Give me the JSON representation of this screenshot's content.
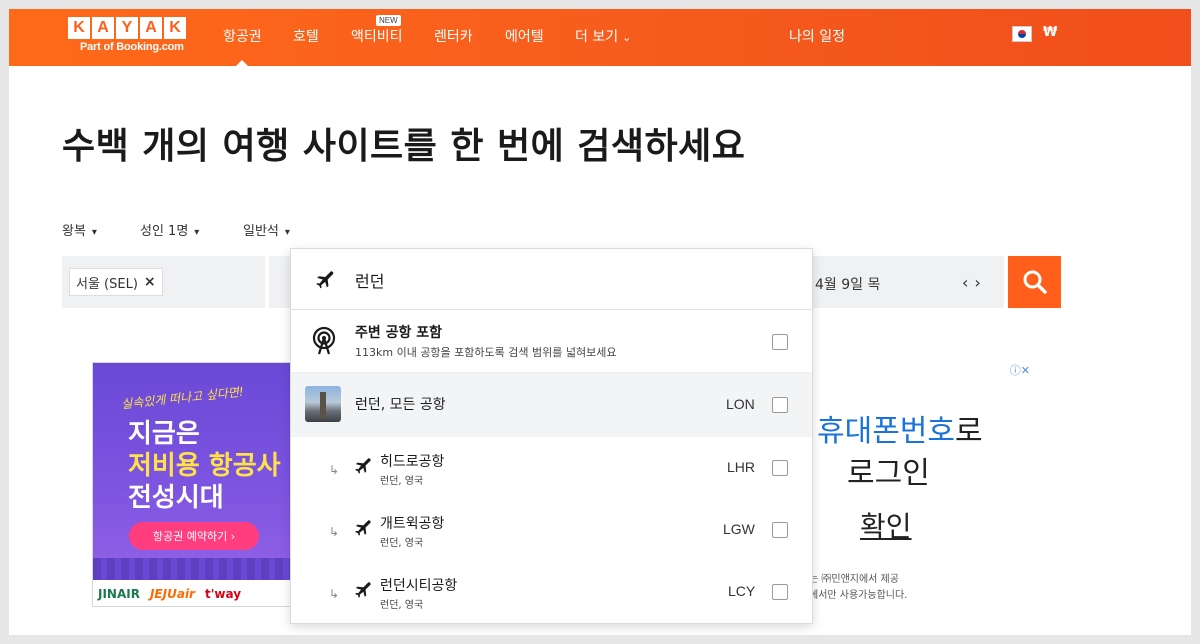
{
  "header": {
    "logo_letters": [
      "K",
      "A",
      "Y",
      "A",
      "K"
    ],
    "logo_sub": "Part of Booking.com",
    "nav": [
      {
        "label": "항공권"
      },
      {
        "label": "호텔"
      },
      {
        "label": "액티비티",
        "badge": "NEW"
      },
      {
        "label": "렌터카"
      },
      {
        "label": "에어텔"
      },
      {
        "label": "더 보기"
      }
    ],
    "trips": "나의 일정",
    "currency": "₩",
    "accent_color": "#ff5f1a"
  },
  "hero": {
    "title": "수백 개의 여행 사이트를 한 번에 검색하세요"
  },
  "options": {
    "trip_type": "왕복",
    "travelers": "성인 1명",
    "cabin": "일반석"
  },
  "search": {
    "origin_chip": "서울 (SEL)",
    "origin_remove": "×",
    "date": "4월 9일 목",
    "prev": "‹",
    "next": "›"
  },
  "dropdown": {
    "query": "런던",
    "nearby_title": "주변 공항 포함",
    "nearby_sub": "113km 이내 공항을 포함하도록 검색 범위를 넓혀보세요",
    "all_airports": {
      "name": "런던, 모든 공항",
      "code": "LON"
    },
    "airports": [
      {
        "name": "히드로공항",
        "loc": "런던, 영국",
        "code": "LHR"
      },
      {
        "name": "개트윅공항",
        "loc": "런던, 영국",
        "code": "LGW"
      },
      {
        "name": "런던시티공항",
        "loc": "런던, 영국",
        "code": "LCY"
      }
    ]
  },
  "ads": {
    "left": {
      "script": "실속있게 떠나고 싶다면!",
      "line1": "지금은",
      "line2": "저비용 항공사",
      "line3": "전성시대",
      "button": "항공권 예약하기 ›",
      "logos": [
        "JINAIR",
        "JEJUair",
        "t'way"
      ]
    },
    "right": {
      "line1_blue": "휴대폰번호",
      "line1_rest": "로",
      "line2": "로그인",
      "confirm": "확인",
      "small1": "는 ㈜민앤지에서 제공",
      "small2": "에서만 사용가능합니다."
    }
  }
}
